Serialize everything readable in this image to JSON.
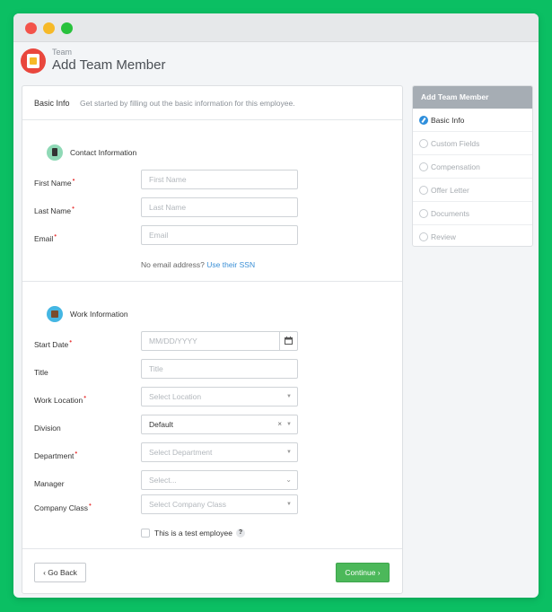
{
  "header": {
    "breadcrumb": "Team",
    "title": "Add Team Member"
  },
  "main": {
    "section_title": "Basic Info",
    "section_description": "Get started by filling out the basic information for this employee."
  },
  "contact": {
    "title": "Contact Information",
    "fields": [
      {
        "label": "First Name",
        "placeholder": "First Name",
        "required": true
      },
      {
        "label": "Last Name",
        "placeholder": "Last Name",
        "required": true
      },
      {
        "label": "Email",
        "placeholder": "Email",
        "required": true
      }
    ],
    "note_text": "No email address?",
    "note_link": "Use their SSN"
  },
  "work": {
    "title": "Work Information",
    "fields": [
      {
        "label": "Start Date",
        "placeholder": "MM/DD/YYYY",
        "required": true
      },
      {
        "label": "Title",
        "placeholder": "Title",
        "required": false
      },
      {
        "label": "Work Location",
        "placeholder": "Select Location",
        "required": true
      },
      {
        "label": "Division",
        "value": "Default",
        "required": false
      },
      {
        "label": "Department",
        "placeholder": "Select Department",
        "required": true
      },
      {
        "label": "Manager",
        "placeholder": "Select...",
        "required": false
      },
      {
        "label": "Company Class",
        "placeholder": "Select Company Class",
        "required": true
      }
    ],
    "test_employee_label": "This is a test employee",
    "help_glyph": "?",
    "clear_glyph": "×"
  },
  "footer": {
    "back_label": "‹ Go Back",
    "continue_label": "Continue ›"
  },
  "sidebar": {
    "title": "Add Team Member",
    "steps": [
      {
        "label": "Basic Info",
        "active": true
      },
      {
        "label": "Custom Fields",
        "active": false
      },
      {
        "label": "Compensation",
        "active": false
      },
      {
        "label": "Offer Letter",
        "active": false
      },
      {
        "label": "Documents",
        "active": false
      },
      {
        "label": "Review",
        "active": false
      }
    ]
  },
  "colors": {
    "background": "#0bbf63",
    "primary_button": "#4cb85a",
    "link": "#3a8fd6",
    "active_step": "#2f8fdc",
    "required": "#e94040"
  },
  "icons": {
    "logo": "team-logo-icon",
    "contact": "contact-card-icon",
    "work": "briefcase-icon",
    "calendar": "calendar-icon",
    "dropdown": "chevron-down-icon",
    "help": "help-icon",
    "check": "check-icon"
  }
}
